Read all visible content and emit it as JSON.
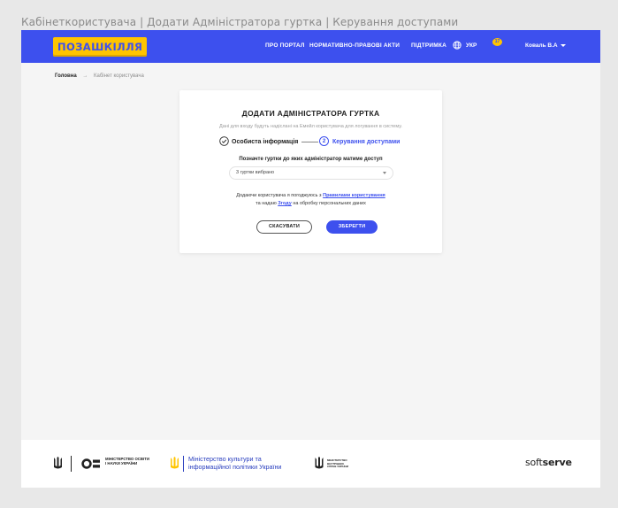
{
  "window": {
    "title": "Кабінеткористувача | Додати Адміністратора гуртка | Керування доступами"
  },
  "header": {
    "logo": "ПОЗАШКІЛЛЯ",
    "nav": {
      "about": "ПРО ПОРТАЛ",
      "legal": "НОРМАТИВНО-ПРАВОВІ АКТИ",
      "support": "ПІДТРИМКА"
    },
    "language": "УКР",
    "notifications_count": "17",
    "user_name": "Коваль В.А",
    "icons": {
      "language": "globe-icon",
      "notifications": "bell-badge-icon",
      "user_menu": "chevron-down-icon"
    },
    "colors": {
      "bar": "#3d50ee",
      "logo_bg": "#ffc400"
    }
  },
  "breadcrumb": {
    "home": "Головна",
    "separator": "→",
    "current": "Кабінет користувача"
  },
  "form": {
    "title": "ДОДАТИ АДМІНІСТРАТОРА ГУРТКА",
    "subtitle": "Дані для входу будуть надіслані на Емейл користувача для логування в систему.",
    "steps": [
      {
        "number": "✓",
        "label": "Особиста інформація",
        "state": "done"
      },
      {
        "number": "2",
        "label": "Керування доступами",
        "state": "active"
      }
    ],
    "clubs_label": "Позначте гуртки до яких адміністратор матиме доступ",
    "clubs_select_value": "3 гуртки вибрано",
    "consent": {
      "line1_prefix": "Додаючи користувача я погоджуюсь з ",
      "rules_link": "Правилами користування",
      "line2_prefix": "та надаю ",
      "consent_link": "Згоду",
      "line2_suffix": " на обробку персональних даних"
    },
    "cancel_label": "СКАСУВАТИ",
    "save_label": "ЗБЕРЕГТИ"
  },
  "footer": {
    "mon_text": "МІНІСТЕРСТВО ОСВІТИ І НАУКИ УКРАЇНИ",
    "mkip_text": "Міністерство культури та інформаційної політики України",
    "mvs_text": "МІНІСТЕРСТВО ВНУТРІШНІХ СПРАВ УКРАЇНИ",
    "softserve_light": "soft",
    "softserve_bold": "serve"
  }
}
